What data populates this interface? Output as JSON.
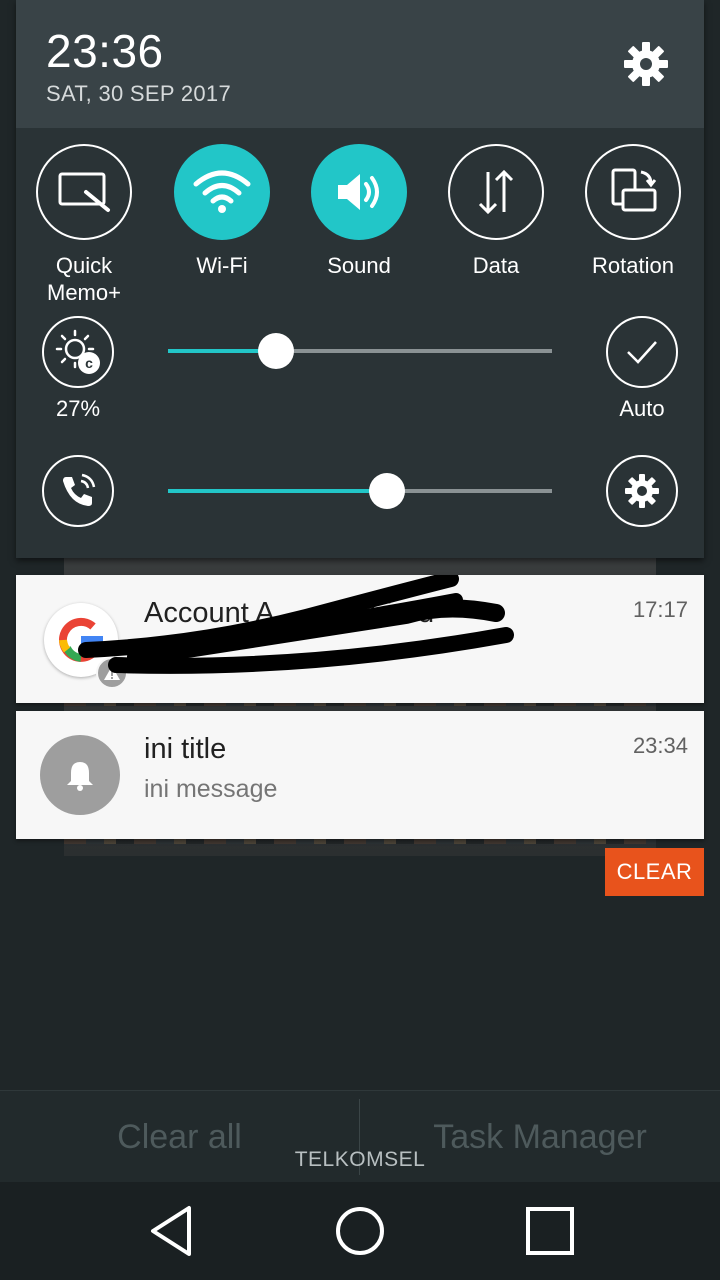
{
  "status": {
    "time": "23:36",
    "date": "SAT, 30 SEP 2017"
  },
  "quick_settings": {
    "toggles": [
      {
        "label": "Quick Memo+",
        "icon": "quick-memo-icon",
        "active": false
      },
      {
        "label": "Wi-Fi",
        "icon": "wifi-icon",
        "active": true
      },
      {
        "label": "Sound",
        "icon": "sound-icon",
        "active": true
      },
      {
        "label": "Data",
        "icon": "data-icon",
        "active": false
      },
      {
        "label": "Rotation",
        "icon": "rotation-icon",
        "active": false
      }
    ],
    "brightness": {
      "percent_label": "27%",
      "level": 0.28,
      "auto_label": "Auto"
    },
    "volume": {
      "level": 0.57
    }
  },
  "notifications": [
    {
      "title": "Account Action Required",
      "title_visible": "Account A          quired",
      "time": "17:17",
      "icon": "google-icon",
      "badge": "warning-icon"
    },
    {
      "title": "ini title",
      "message": "ini message",
      "time": "23:34",
      "icon": "bell-icon"
    }
  ],
  "clear_button": "CLEAR",
  "bottom_bar": {
    "clear_all": "Clear all",
    "task_manager": "Task Manager"
  },
  "carrier": "TELKOMSEL",
  "colors": {
    "accent": "#22c6c8",
    "clear_button": "#e8531c"
  }
}
